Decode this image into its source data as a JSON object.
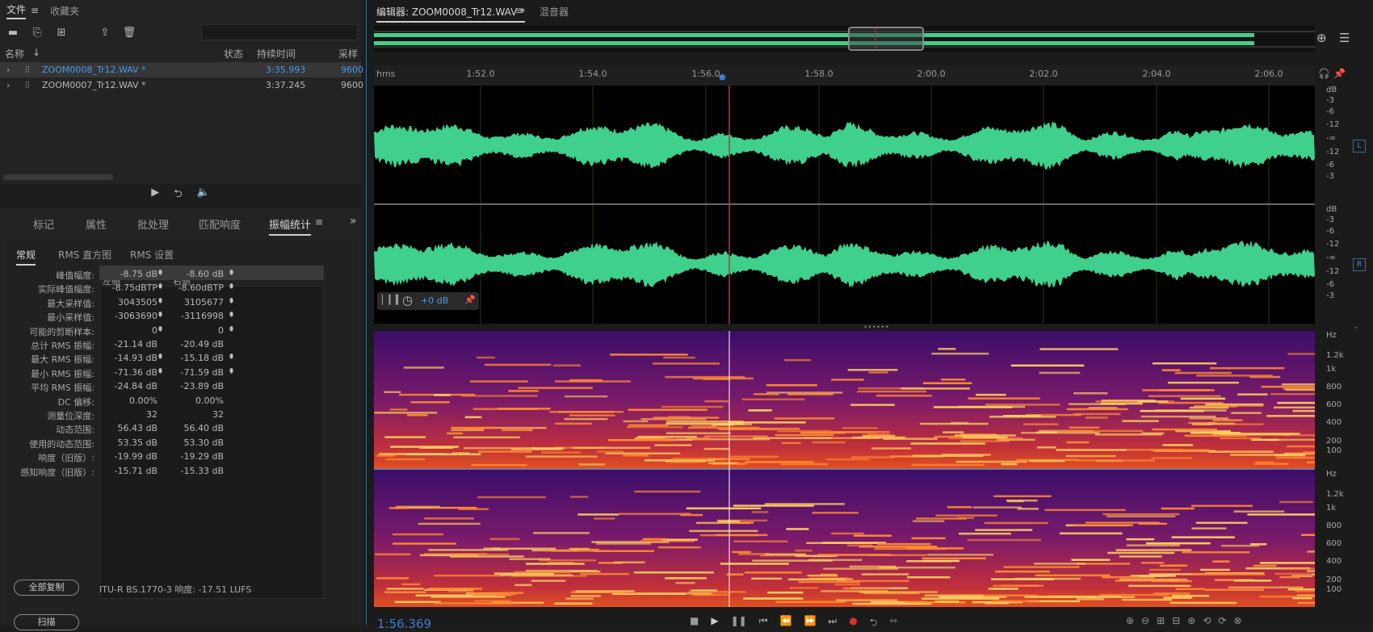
{
  "files_panel": {
    "tabs": [
      "文件",
      "收藏夹"
    ],
    "search_placeholder": "",
    "columns": [
      "名称",
      "状态",
      "持续时间",
      "采样"
    ],
    "files": [
      {
        "name": "ZOOM0008_Tr12.WAV *",
        "duration": "3:35.993",
        "rate": "9600",
        "selected": true
      },
      {
        "name": "ZOOM0007_Tr12.WAV *",
        "duration": "3:37.245",
        "rate": "9600",
        "selected": false
      }
    ]
  },
  "stats_panel": {
    "tabs": [
      "标记",
      "属性",
      "批处理",
      "匹配响度",
      "振幅统计"
    ],
    "subtabs": [
      "常规",
      "RMS 直方图",
      "RMS 设置"
    ],
    "col_left": "左侧",
    "col_right": "右侧",
    "rows": [
      {
        "label": "峰值幅度:",
        "left": "-8.75 dB",
        "right": "-8.60 dB",
        "marker": true
      },
      {
        "label": "实际峰值幅度:",
        "left": "-8.75dBTP",
        "right": "-8.60dBTP",
        "marker": true
      },
      {
        "label": "最大采样值:",
        "left": "3043505",
        "right": "3105677",
        "marker": true
      },
      {
        "label": "最小采样值:",
        "left": "-3063690",
        "right": "-3116998",
        "marker": true
      },
      {
        "label": "可能的剪断样本:",
        "left": "0",
        "right": "0",
        "marker": true
      },
      {
        "label": "总计 RMS 振幅:",
        "left": "-21.14 dB",
        "right": "-20.49 dB",
        "marker": false
      },
      {
        "label": "最大 RMS 振幅:",
        "left": "-14.93 dB",
        "right": "-15.18 dB",
        "marker": true
      },
      {
        "label": "最小 RMS 振幅:",
        "left": "-71.36 dB",
        "right": "-71.59 dB",
        "marker": true
      },
      {
        "label": "平均 RMS 振幅:",
        "left": "-24.84 dB",
        "right": "-23.89 dB",
        "marker": false
      },
      {
        "label": "DC 偏移:",
        "left": "0.00%",
        "right": "0.00%",
        "marker": false
      },
      {
        "label": "测量位深度:",
        "left": "32",
        "right": "32",
        "marker": false
      },
      {
        "label": "动态范围:",
        "left": "56.43 dB",
        "right": "56.40 dB",
        "marker": false
      },
      {
        "label": "使用的动态范围:",
        "left": "53.35 dB",
        "right": "53.30 dB",
        "marker": false
      },
      {
        "label": "响度（旧版）:",
        "left": "-19.99 dB",
        "right": "-19.29 dB",
        "marker": false
      },
      {
        "label": "感知响度（旧版）:",
        "left": "-15.71 dB",
        "right": "-15.33 dB",
        "marker": false
      }
    ],
    "copy_all": "全部复制",
    "loudness": "ITU-R BS.1770-3 响度:  -17.51 LUFS",
    "scan": "扫描"
  },
  "editor": {
    "tab_label": "编辑器: ZOOM0008_Tr12.WAV *",
    "mixer_label": "混音器",
    "ruler": {
      "unit": "hms",
      "ticks": [
        "1:52.0",
        "1:54.0",
        "1:56.0",
        "1:58.0",
        "2:00.0",
        "2:02.0",
        "2:04.0",
        "2:06.0"
      ]
    },
    "db_scale_top": [
      "dB",
      "-3",
      "-6",
      "-12",
      "-∞",
      "-12",
      "-6",
      "-3"
    ],
    "db_scale_bottom": [
      "dB",
      "-3",
      "-6",
      "-12",
      "-∞",
      "-12",
      "-6",
      "-3"
    ],
    "hz_scale_top": [
      "Hz",
      "1.2k",
      "1k",
      "800",
      "600",
      "400",
      "200",
      "100"
    ],
    "hz_scale_bottom": [
      "Hz",
      "1.2k",
      "1k",
      "800",
      "600",
      "400",
      "200",
      "100"
    ],
    "channel_left": "L",
    "channel_right": "R",
    "gain": "+0 dB",
    "time": "1:56.369",
    "colors": {
      "waveform": "#3ed08c",
      "playhead": "#d03030",
      "accent": "#3a7fd0"
    }
  }
}
